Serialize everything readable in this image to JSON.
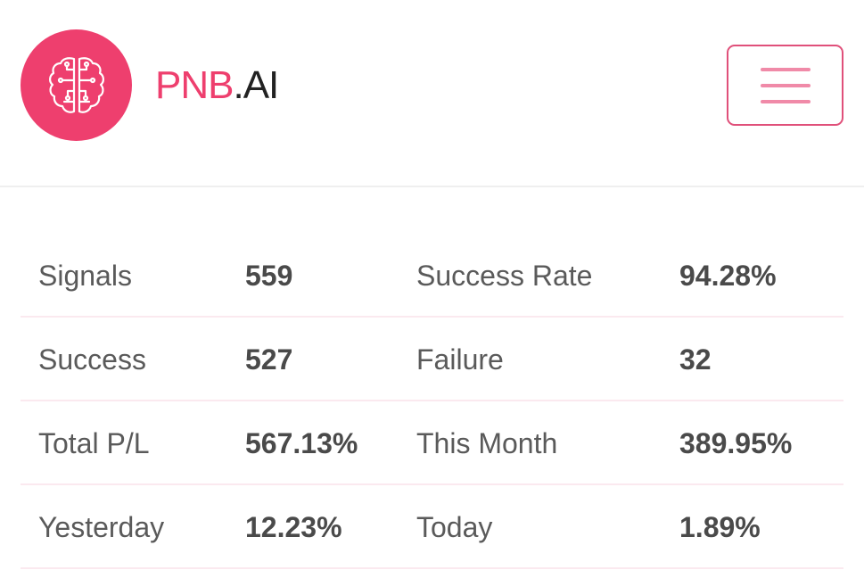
{
  "brand": {
    "name_part1": "PNB",
    "name_part2": ".AI",
    "logo_icon": "brain-circuit-icon",
    "accent_color": "#ee3f6e"
  },
  "menu": {
    "icon": "hamburger-menu-icon"
  },
  "stats": [
    {
      "label_left": "Signals",
      "value_left": "559",
      "label_right": "Success Rate",
      "value_right": "94.28%"
    },
    {
      "label_left": "Success",
      "value_left": "527",
      "label_right": "Failure",
      "value_right": "32"
    },
    {
      "label_left": "Total P/L",
      "value_left": "567.13%",
      "label_right": "This Month",
      "value_right": "389.95%"
    },
    {
      "label_left": "Yesterday",
      "value_left": "12.23%",
      "label_right": "Today",
      "value_right": "1.89%"
    }
  ]
}
